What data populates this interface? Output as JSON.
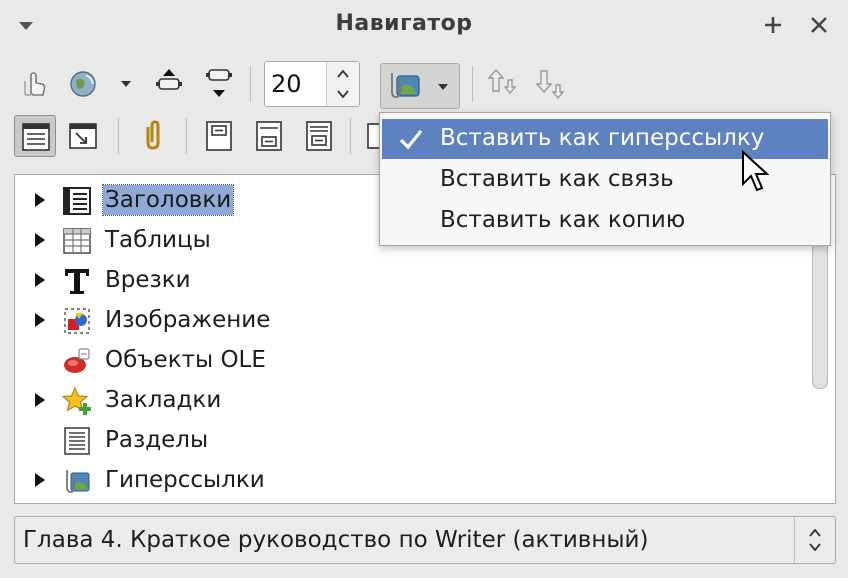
{
  "window": {
    "title": "Навигатор",
    "add_glyph": "+",
    "close_glyph": "×"
  },
  "toolbar": {
    "spin_value": "20"
  },
  "tree": {
    "items": [
      {
        "label": "Заголовки",
        "icon": "headings-icon",
        "expandable": true,
        "selected": true
      },
      {
        "label": "Таблицы",
        "icon": "table-icon",
        "expandable": true
      },
      {
        "label": "Врезки",
        "icon": "text-frame-icon",
        "expandable": true
      },
      {
        "label": "Изображение",
        "icon": "image-icon",
        "expandable": true
      },
      {
        "label": "Объекты OLE",
        "icon": "ole-object-icon",
        "expandable": false
      },
      {
        "label": "Закладки",
        "icon": "bookmark-icon",
        "expandable": true
      },
      {
        "label": "Разделы",
        "icon": "section-icon",
        "expandable": false
      },
      {
        "label": "Гиперссылки",
        "icon": "hyperlink-icon",
        "expandable": true
      }
    ]
  },
  "drag_menu": {
    "items": [
      {
        "label": "Вставить как гиперссылку",
        "checked": true
      },
      {
        "label": "Вставить как связь",
        "checked": false
      },
      {
        "label": "Вставить как копию",
        "checked": false
      }
    ]
  },
  "document_select": {
    "value": "Глава 4. Краткое руководство по Writer (активный)"
  },
  "colors": {
    "menu_highlight": "#5d82bf",
    "tree_selection": "#90a9d6",
    "window_bg": "#e9e9e8"
  }
}
